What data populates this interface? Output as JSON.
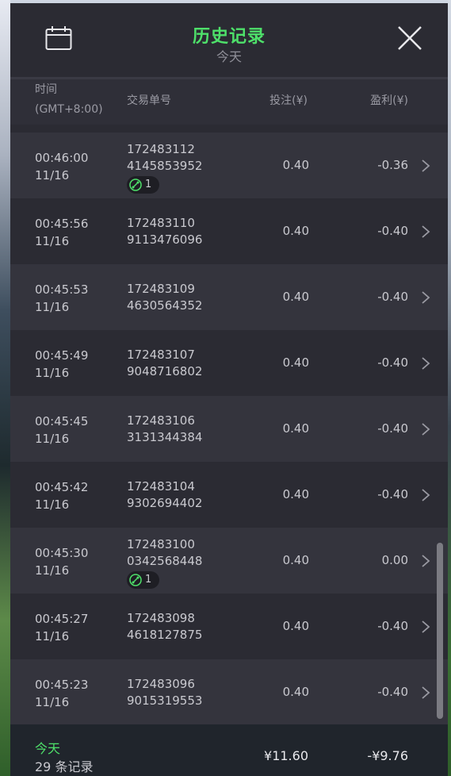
{
  "header": {
    "title": "历史记录",
    "subtitle": "今天",
    "calendar_icon": "calendar-icon",
    "close_icon": "close-icon"
  },
  "columns": {
    "time_label": "时间",
    "timezone": "(GMT+8:00)",
    "order_label": "交易单号",
    "bet_label": "投注(¥)",
    "profit_label": "盈利(¥)"
  },
  "rows": [
    {
      "time": "00:46:00",
      "date": "11/16",
      "order1": "172483112",
      "order2": "4145853952",
      "bet": "0.40",
      "profit": "-0.36",
      "parlay": "1"
    },
    {
      "time": "00:45:56",
      "date": "11/16",
      "order1": "172483110",
      "order2": "9113476096",
      "bet": "0.40",
      "profit": "-0.40"
    },
    {
      "time": "00:45:53",
      "date": "11/16",
      "order1": "172483109",
      "order2": "4630564352",
      "bet": "0.40",
      "profit": "-0.40"
    },
    {
      "time": "00:45:49",
      "date": "11/16",
      "order1": "172483107",
      "order2": "9048716802",
      "bet": "0.40",
      "profit": "-0.40"
    },
    {
      "time": "00:45:45",
      "date": "11/16",
      "order1": "172483106",
      "order2": "3131344384",
      "bet": "0.40",
      "profit": "-0.40"
    },
    {
      "time": "00:45:42",
      "date": "11/16",
      "order1": "172483104",
      "order2": "9302694402",
      "bet": "0.40",
      "profit": "-0.40"
    },
    {
      "time": "00:45:30",
      "date": "11/16",
      "order1": "172483100",
      "order2": "0342568448",
      "bet": "0.40",
      "profit": "0.00",
      "parlay": "1"
    },
    {
      "time": "00:45:27",
      "date": "11/16",
      "order1": "172483098",
      "order2": "4618127875",
      "bet": "0.40",
      "profit": "-0.40"
    },
    {
      "time": "00:45:23",
      "date": "11/16",
      "order1": "172483096",
      "order2": "9015319553",
      "bet": "0.40",
      "profit": "-0.40"
    }
  ],
  "footer": {
    "period": "今天",
    "record_count": "29 条记录",
    "total_bet": "¥11.60",
    "total_profit": "-¥9.76"
  },
  "colors": {
    "accent": "#4ee06a",
    "panel": "#2b2b33",
    "row_alt": "#34343d",
    "footer": "#20252c"
  }
}
